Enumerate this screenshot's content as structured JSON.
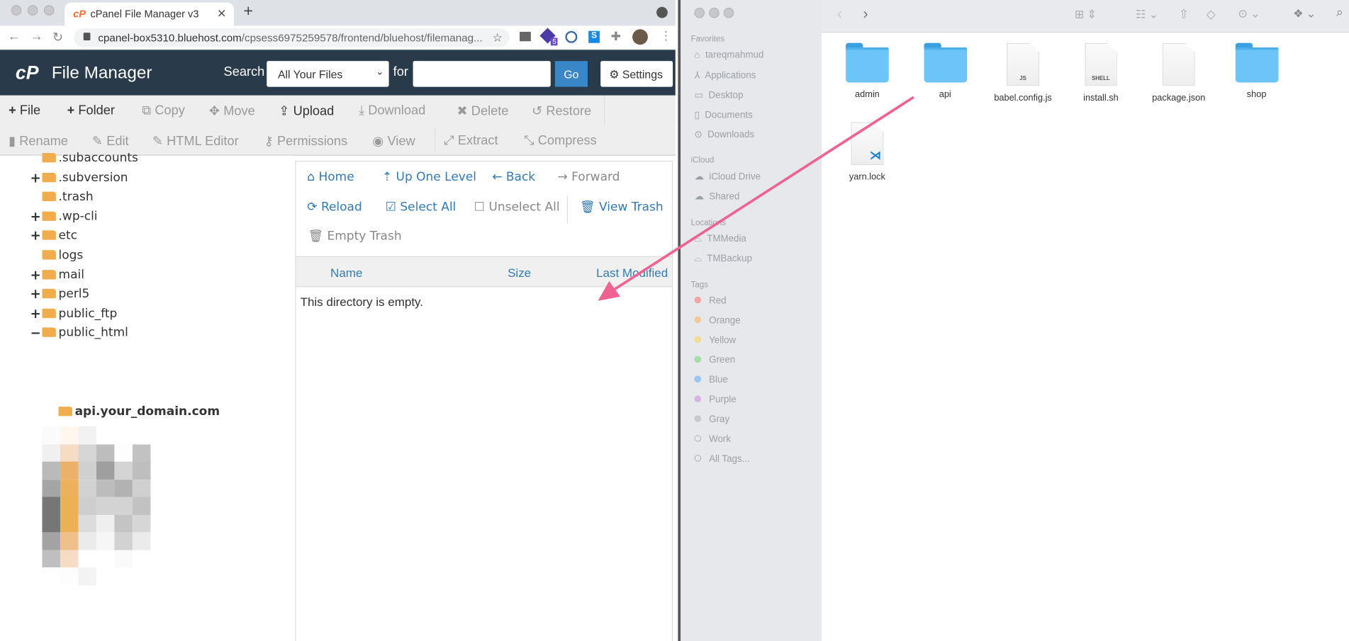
{
  "browser": {
    "tab_title": "cPanel File Manager v3",
    "url_host": "cpanel-box5310.bluehost.com",
    "url_path": "/cpsess6975259578/frontend/bluehost/filemanag...",
    "extension_badge": "5"
  },
  "header": {
    "app_title": "File Manager",
    "search_label": "Search",
    "search_scope": "All Your Files",
    "for_label": "for",
    "search_value": "",
    "go_label": "Go",
    "settings_label": "Settings"
  },
  "toolbar": {
    "row1": [
      {
        "label": "File",
        "icon": "plus-icon",
        "enabled": true
      },
      {
        "label": "Folder",
        "icon": "plus-icon",
        "enabled": true
      },
      {
        "label": "Copy",
        "icon": "copy-icon",
        "enabled": false
      },
      {
        "label": "Move",
        "icon": "move-icon",
        "enabled": false
      },
      {
        "label": "Upload",
        "icon": "upload-icon",
        "enabled": true
      },
      {
        "label": "Download",
        "icon": "download-icon",
        "enabled": false
      },
      {
        "label": "Delete",
        "icon": "x-icon",
        "enabled": false
      },
      {
        "label": "Restore",
        "icon": "undo-icon",
        "enabled": false
      }
    ],
    "row2": [
      {
        "label": "Rename",
        "icon": "file-icon",
        "enabled": false
      },
      {
        "label": "Edit",
        "icon": "pencil-icon",
        "enabled": false
      },
      {
        "label": "HTML Editor",
        "icon": "edit-icon",
        "enabled": false
      },
      {
        "label": "Permissions",
        "icon": "key-icon",
        "enabled": false
      },
      {
        "label": "View",
        "icon": "eye-icon",
        "enabled": false
      },
      {
        "label": "Extract",
        "icon": "expand-icon",
        "enabled": false
      },
      {
        "label": "Compress",
        "icon": "compress-icon",
        "enabled": false
      }
    ]
  },
  "tree": {
    "items": [
      {
        "name": ".subaccounts",
        "toggle": ""
      },
      {
        "name": ".subversion",
        "toggle": "+"
      },
      {
        "name": ".trash",
        "toggle": ""
      },
      {
        "name": ".wp-cli",
        "toggle": "+"
      },
      {
        "name": "etc",
        "toggle": "+"
      },
      {
        "name": "logs",
        "toggle": ""
      },
      {
        "name": "mail",
        "toggle": "+"
      },
      {
        "name": "perl5",
        "toggle": "+"
      },
      {
        "name": "public_ftp",
        "toggle": "+"
      },
      {
        "name": "public_html",
        "toggle": "−"
      }
    ],
    "selected": "api.your_domain.com"
  },
  "nav": {
    "home": "Home",
    "up": "Up One Level",
    "back": "Back",
    "forward": "Forward",
    "reload": "Reload",
    "select_all": "Select All",
    "unselect_all": "Unselect All",
    "view_trash": "View Trash",
    "empty_trash": "Empty Trash"
  },
  "table": {
    "columns": [
      "Name",
      "Size",
      "Last Modified"
    ],
    "empty_message": "This directory is empty."
  },
  "finder": {
    "sections": {
      "favorites": "Favorites",
      "icloud": "iCloud",
      "locations": "Locations",
      "tags": "Tags"
    },
    "favorites": [
      "tareqmahmud",
      "Applications",
      "Desktop",
      "Documents",
      "Downloads"
    ],
    "icloud": [
      "iCloud Drive",
      "Shared"
    ],
    "locations": [
      "TMMedia",
      "TMBackup"
    ],
    "tags": [
      {
        "name": "Red",
        "color": "#f2a7a4"
      },
      {
        "name": "Orange",
        "color": "#f2c99a"
      },
      {
        "name": "Yellow",
        "color": "#f2dc94"
      },
      {
        "name": "Green",
        "color": "#a6dca6"
      },
      {
        "name": "Blue",
        "color": "#9cc6f2"
      },
      {
        "name": "Purple",
        "color": "#d6b4e4"
      },
      {
        "name": "Gray",
        "color": "#c8c9cc"
      },
      {
        "name": "Work",
        "color": "transparent"
      },
      {
        "name": "All Tags...",
        "color": "transparent"
      }
    ],
    "files": [
      {
        "name": "admin",
        "kind": "folder"
      },
      {
        "name": "api",
        "kind": "folder"
      },
      {
        "name": "babel.config.js",
        "kind": "doc",
        "badge": "JS"
      },
      {
        "name": "install.sh",
        "kind": "doc",
        "badge": "SHELL"
      },
      {
        "name": "package.json",
        "kind": "doc",
        "badge": ""
      },
      {
        "name": "shop",
        "kind": "folder"
      },
      {
        "name": "yarn.lock",
        "kind": "doc",
        "badge": ""
      }
    ]
  },
  "colors": {
    "cpanel_header": "#293a4a",
    "link": "#337ab7",
    "folder": "#f0ad4e",
    "arrow": "#f06292",
    "go_button": "#3a87c8"
  }
}
